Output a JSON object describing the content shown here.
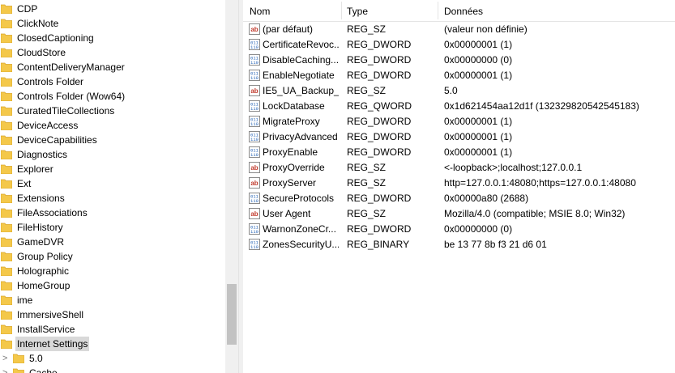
{
  "tree": {
    "items": [
      {
        "label": "CDP"
      },
      {
        "label": "ClickNote"
      },
      {
        "label": "ClosedCaptioning"
      },
      {
        "label": "CloudStore"
      },
      {
        "label": "ContentDeliveryManager"
      },
      {
        "label": "Controls Folder"
      },
      {
        "label": "Controls Folder (Wow64)"
      },
      {
        "label": "CuratedTileCollections"
      },
      {
        "label": "DeviceAccess"
      },
      {
        "label": "DeviceCapabilities"
      },
      {
        "label": "Diagnostics"
      },
      {
        "label": "Explorer"
      },
      {
        "label": "Ext"
      },
      {
        "label": "Extensions"
      },
      {
        "label": "FileAssociations"
      },
      {
        "label": "FileHistory"
      },
      {
        "label": "GameDVR"
      },
      {
        "label": "Group Policy"
      },
      {
        "label": "Holographic"
      },
      {
        "label": "HomeGroup"
      },
      {
        "label": "ime"
      },
      {
        "label": "ImmersiveShell"
      },
      {
        "label": "InstallService"
      },
      {
        "label": "Internet Settings",
        "selected": true
      }
    ],
    "children": [
      {
        "label": "5.0",
        "expander": ">"
      },
      {
        "label": "Cache",
        "expander": ">"
      }
    ]
  },
  "values": {
    "headers": {
      "name": "Nom",
      "type": "Type",
      "data": "Données"
    },
    "rows": [
      {
        "icon": "string-value-icon",
        "name": "(par défaut)",
        "type": "REG_SZ",
        "data": "(valeur non définie)"
      },
      {
        "icon": "binary-value-icon",
        "name": "CertificateRevoc...",
        "type": "REG_DWORD",
        "data": "0x00000001 (1)"
      },
      {
        "icon": "binary-value-icon",
        "name": "DisableCaching...",
        "type": "REG_DWORD",
        "data": "0x00000000 (0)"
      },
      {
        "icon": "binary-value-icon",
        "name": "EnableNegotiate",
        "type": "REG_DWORD",
        "data": "0x00000001 (1)"
      },
      {
        "icon": "string-value-icon",
        "name": "IE5_UA_Backup_...",
        "type": "REG_SZ",
        "data": "5.0"
      },
      {
        "icon": "binary-value-icon",
        "name": "LockDatabase",
        "type": "REG_QWORD",
        "data": "0x1d621454aa12d1f (132329820542545183)"
      },
      {
        "icon": "binary-value-icon",
        "name": "MigrateProxy",
        "type": "REG_DWORD",
        "data": "0x00000001 (1)"
      },
      {
        "icon": "binary-value-icon",
        "name": "PrivacyAdvanced",
        "type": "REG_DWORD",
        "data": "0x00000001 (1)"
      },
      {
        "icon": "binary-value-icon",
        "name": "ProxyEnable",
        "type": "REG_DWORD",
        "data": "0x00000001 (1)"
      },
      {
        "icon": "string-value-icon",
        "name": "ProxyOverride",
        "type": "REG_SZ",
        "data": "<-loopback>;localhost;127.0.0.1"
      },
      {
        "icon": "string-value-icon",
        "name": "ProxyServer",
        "type": "REG_SZ",
        "data": "http=127.0.0.1:48080;https=127.0.0.1:48080"
      },
      {
        "icon": "binary-value-icon",
        "name": "SecureProtocols",
        "type": "REG_DWORD",
        "data": "0x00000a80 (2688)"
      },
      {
        "icon": "string-value-icon",
        "name": "User Agent",
        "type": "REG_SZ",
        "data": "Mozilla/4.0 (compatible; MSIE 8.0; Win32)"
      },
      {
        "icon": "binary-value-icon",
        "name": "WarnonZoneCr...",
        "type": "REG_DWORD",
        "data": "0x00000000 (0)"
      },
      {
        "icon": "binary-value-icon",
        "name": "ZonesSecurityU...",
        "type": "REG_BINARY",
        "data": "be 13 77 8b f3 21 d6 01"
      }
    ]
  },
  "colors": {
    "folder": "#f4c84a",
    "selected": "#d9d9d9",
    "string_icon": "#c0392b",
    "binary_icon": "#1f5fb4"
  }
}
